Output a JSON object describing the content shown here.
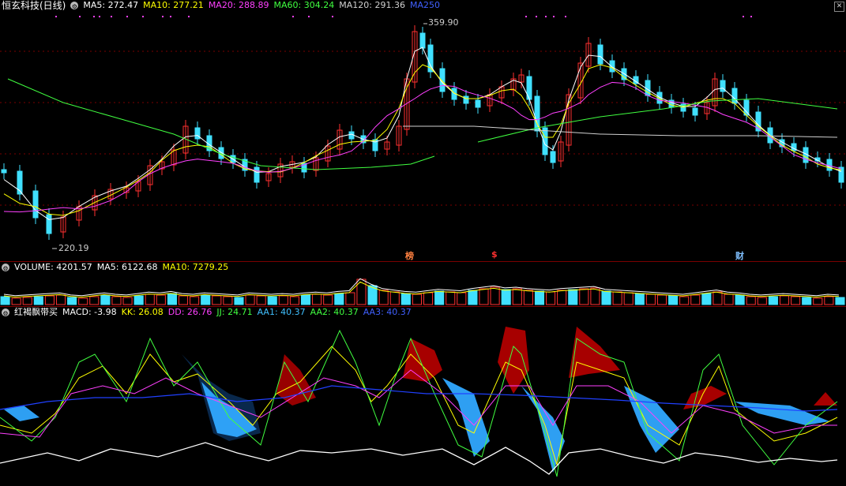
{
  "main": {
    "title": "恒玄科技(日线)",
    "ma": [
      {
        "label": "MA5: 272.47",
        "color": "#ffffff"
      },
      {
        "label": "MA10: 277.21",
        "color": "#ffff00"
      },
      {
        "label": "MA20: 288.89",
        "color": "#ff40ff"
      },
      {
        "label": "MA60: 304.24",
        "color": "#40ff40"
      },
      {
        "label": "MA120: 291.36",
        "color": "#d0d0d0"
      },
      {
        "label": "MA250",
        "color": "#4060ff"
      }
    ],
    "high_label": "359.90",
    "low_label": "220.19",
    "markers": [
      {
        "text": "榜",
        "color": "#ff8040"
      },
      {
        "text": "$",
        "color": "#ff3030"
      },
      {
        "text": "财",
        "color": "#80c0ff"
      }
    ]
  },
  "volume": {
    "items": [
      {
        "label": "VOLUME: 4201.57",
        "color": "#ffffff"
      },
      {
        "label": "MA5: 6122.68",
        "color": "#ffffff"
      },
      {
        "label": "MA10: 7279.25",
        "color": "#ffff00"
      }
    ]
  },
  "indicator": {
    "name": "红褐飘带买",
    "items": [
      {
        "label": "MACD: -3.98",
        "color": "#ffffff"
      },
      {
        "label": "KK: 26.08",
        "color": "#ffff00"
      },
      {
        "label": "DD: 26.76",
        "color": "#ff40ff"
      },
      {
        "label": "JJ: 24.71",
        "color": "#40ff40"
      },
      {
        "label": "AA1: 40.37",
        "color": "#40c0ff"
      },
      {
        "label": "AA2: 40.37",
        "color": "#40ff40"
      },
      {
        "label": "AA3: 40.37",
        "color": "#4060ff"
      }
    ]
  },
  "colors": {
    "up": "#ff3030",
    "down": "#40e0ff",
    "grid": "#7a0000"
  }
}
